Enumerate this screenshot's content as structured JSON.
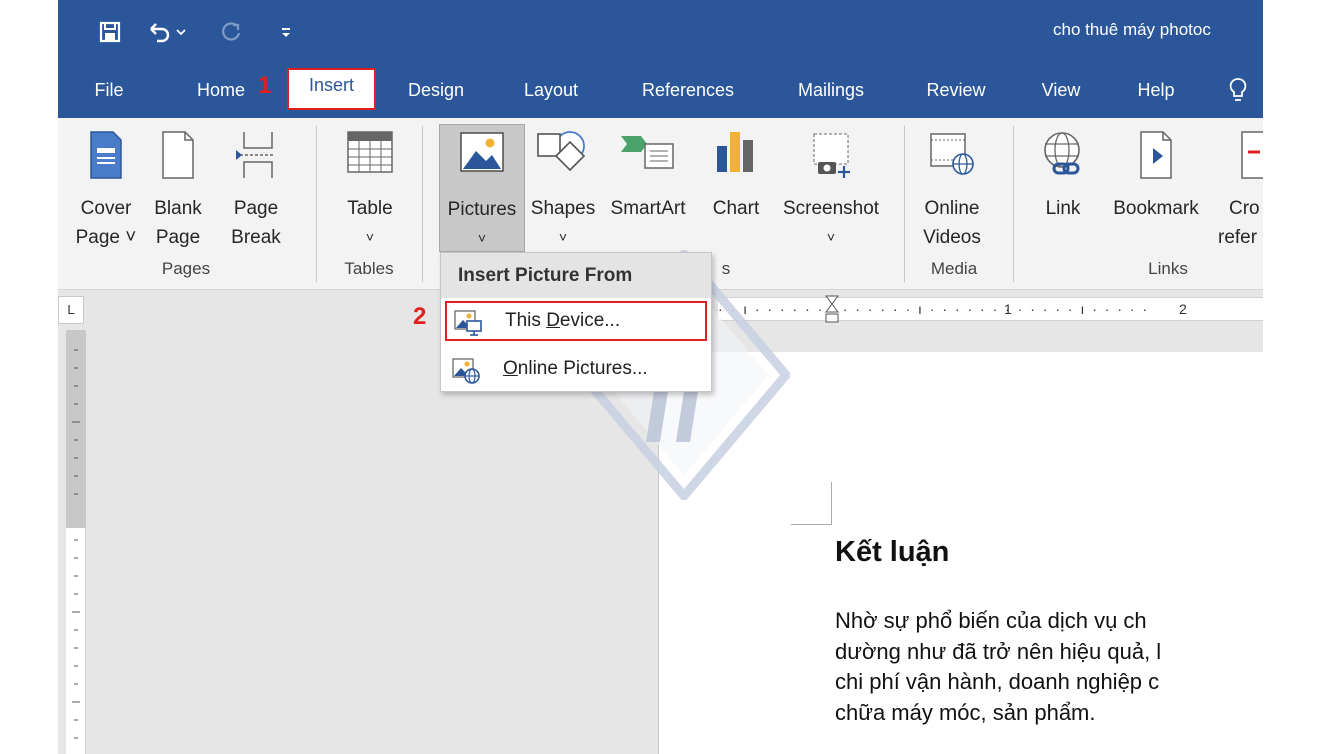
{
  "window": {
    "title": "cho thuê máy photoc"
  },
  "quick_access": {
    "items": [
      "save-icon",
      "undo-icon",
      "redo-icon",
      "customize-icon"
    ]
  },
  "tabs": [
    {
      "label": "File"
    },
    {
      "label": "Home"
    },
    {
      "label": "Insert"
    },
    {
      "label": "Design"
    },
    {
      "label": "Layout"
    },
    {
      "label": "References"
    },
    {
      "label": "Mailings"
    },
    {
      "label": "Review"
    },
    {
      "label": "View"
    },
    {
      "label": "Help"
    }
  ],
  "active_tab": "Insert",
  "steps": {
    "one": "1",
    "two": "2"
  },
  "ribbon": {
    "buttons": [
      {
        "label1": "Cover",
        "label2": "Page ˅",
        "icon": "cover-page-icon"
      },
      {
        "label1": "Blank",
        "label2": "Page",
        "icon": "blank-page-icon"
      },
      {
        "label1": "Page",
        "label2": "Break",
        "icon": "page-break-icon"
      },
      {
        "label1": "Table",
        "label2": "˅",
        "icon": "table-icon"
      },
      {
        "label1": "Pictures",
        "label2": "˅",
        "icon": "pictures-icon"
      },
      {
        "label1": "Shapes",
        "label2": "˅",
        "icon": "shapes-icon"
      },
      {
        "label1": "SmartArt",
        "label2": "",
        "icon": "smartart-icon"
      },
      {
        "label1": "Chart",
        "label2": "",
        "icon": "chart-icon"
      },
      {
        "label1": "Screenshot",
        "label2": "˅",
        "icon": "screenshot-icon"
      },
      {
        "label1": "Online",
        "label2": "Videos",
        "icon": "online-videos-icon"
      },
      {
        "label1": "Link",
        "label2": "",
        "icon": "link-icon"
      },
      {
        "label1": "Bookmark",
        "label2": "",
        "icon": "bookmark-icon"
      },
      {
        "label1": "Cro",
        "label2": "refer",
        "icon": "cross-reference-icon"
      }
    ],
    "groups": [
      "Pages",
      "Tables",
      "s",
      "Media",
      "Links"
    ]
  },
  "dropdown": {
    "title": "Insert Picture From",
    "items": [
      {
        "pre": "This ",
        "key": "D",
        "post": "evice...",
        "icon": "this-device-icon"
      },
      {
        "pre": "",
        "key": "O",
        "post": "nline Pictures...",
        "icon": "online-pictures-icon"
      }
    ]
  },
  "ruler": {
    "marks": [
      "1",
      "2"
    ],
    "corner": "L"
  },
  "document": {
    "heading": "Kết luận",
    "lines": [
      "Nhờ sự phổ biến của dịch vụ ch",
      "dường như đã trở nên hiệu quả, l",
      "chi phí vận hành, doanh nghiệp c",
      "chữa máy móc, sản phẩm."
    ]
  },
  "colors": {
    "accent": "#2b579a",
    "highlight": "#e02020",
    "ribbon": "#f3f3f3"
  }
}
